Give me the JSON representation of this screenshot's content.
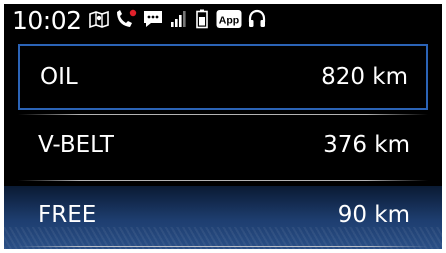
{
  "status_bar": {
    "time": "10:02",
    "app_badge": "App",
    "icons": [
      "map-icon",
      "missed-call-icon",
      "message-icon",
      "signal-icon",
      "battery-icon",
      "app-icon",
      "headphones-icon"
    ],
    "colors": {
      "missed_call": "#e0202a"
    }
  },
  "maintenance_list": {
    "items": [
      {
        "label": "OIL",
        "value": "820 km",
        "selected": true
      },
      {
        "label": "V-BELT",
        "value": "376 km",
        "selected": false
      },
      {
        "label": "FREE",
        "value": "90 km",
        "selected": false
      }
    ]
  },
  "colors": {
    "background": "#000000",
    "selection_border": "#2b63b6",
    "bottom_glow": "#2a4f86"
  }
}
